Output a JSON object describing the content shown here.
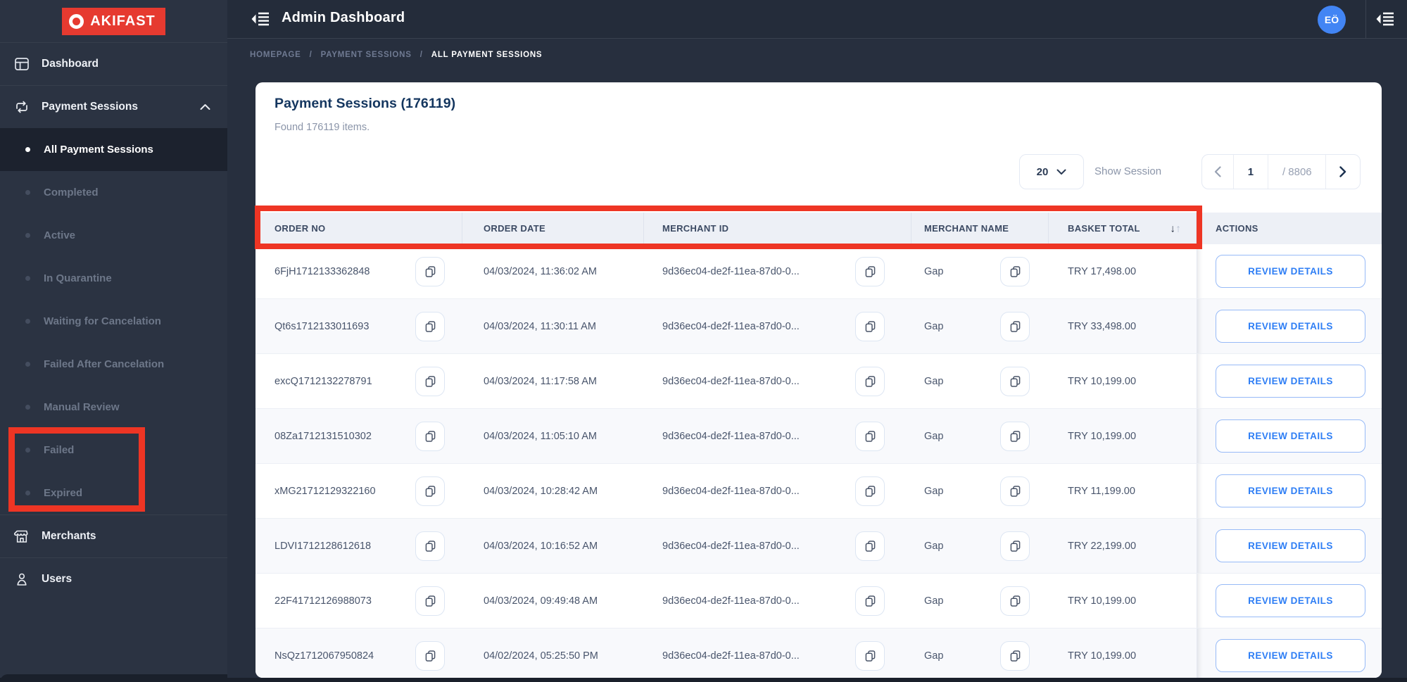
{
  "brand": {
    "logo_text": "AKIFAST"
  },
  "topbar": {
    "title": "Admin Dashboard",
    "avatar_initials": "EÖ"
  },
  "breadcrumb": {
    "separator": "/",
    "items": [
      "HOMEPAGE",
      "PAYMENT SESSIONS",
      "ALL PAYMENT SESSIONS"
    ]
  },
  "sidebar": {
    "items": [
      {
        "label": "Dashboard",
        "icon": "dashboard-icon",
        "type": "main"
      },
      {
        "label": "Payment Sessions",
        "icon": "payment-sessions-icon",
        "type": "main",
        "expanded": true
      },
      {
        "label": "All Payment Sessions",
        "type": "sub",
        "active": true
      },
      {
        "label": "Completed",
        "type": "sub"
      },
      {
        "label": "Active",
        "type": "sub"
      },
      {
        "label": "In Quarantine",
        "type": "sub"
      },
      {
        "label": "Waiting for Cancelation",
        "type": "sub"
      },
      {
        "label": "Failed After Cancelation",
        "type": "sub"
      },
      {
        "label": "Manual Review",
        "type": "sub"
      },
      {
        "label": "Failed",
        "type": "sub"
      },
      {
        "label": "Expired",
        "type": "sub"
      },
      {
        "label": "Merchants",
        "icon": "merchants-icon",
        "type": "main"
      },
      {
        "label": "Users",
        "icon": "users-icon",
        "type": "main"
      }
    ]
  },
  "page": {
    "title": "Payment Sessions (176119)",
    "subtitle": "Found 176119 items.",
    "page_size": "20",
    "page_size_label": "Show Session",
    "pager": {
      "current": "1",
      "total": "/ 8806"
    }
  },
  "table": {
    "columns": [
      "ORDER NO",
      "ORDER DATE",
      "MERCHANT ID",
      "MERCHANT NAME",
      "BASKET TOTAL",
      "ACTIONS"
    ],
    "sorted_column": "BASKET TOTAL",
    "action_label": "REVIEW DETAILS",
    "rows": [
      {
        "order_no": "6FjH1712133362848",
        "order_date": "04/03/2024, 11:36:02 AM",
        "merchant_id": "9d36ec04-de2f-11ea-87d0-0...",
        "merchant_name": "Gap",
        "basket_total": "TRY 17,498.00"
      },
      {
        "order_no": "Qt6s1712133011693",
        "order_date": "04/03/2024, 11:30:11 AM",
        "merchant_id": "9d36ec04-de2f-11ea-87d0-0...",
        "merchant_name": "Gap",
        "basket_total": "TRY 33,498.00"
      },
      {
        "order_no": "excQ1712132278791",
        "order_date": "04/03/2024, 11:17:58 AM",
        "merchant_id": "9d36ec04-de2f-11ea-87d0-0...",
        "merchant_name": "Gap",
        "basket_total": "TRY 10,199.00"
      },
      {
        "order_no": "08Za1712131510302",
        "order_date": "04/03/2024, 11:05:10 AM",
        "merchant_id": "9d36ec04-de2f-11ea-87d0-0...",
        "merchant_name": "Gap",
        "basket_total": "TRY 10,199.00"
      },
      {
        "order_no": "xMG21712129322160",
        "order_date": "04/03/2024, 10:28:42 AM",
        "merchant_id": "9d36ec04-de2f-11ea-87d0-0...",
        "merchant_name": "Gap",
        "basket_total": "TRY 11,199.00"
      },
      {
        "order_no": "LDVI1712128612618",
        "order_date": "04/03/2024, 10:16:52 AM",
        "merchant_id": "9d36ec04-de2f-11ea-87d0-0...",
        "merchant_name": "Gap",
        "basket_total": "TRY 22,199.00"
      },
      {
        "order_no": "22F41712126988073",
        "order_date": "04/03/2024, 09:49:48 AM",
        "merchant_id": "9d36ec04-de2f-11ea-87d0-0...",
        "merchant_name": "Gap",
        "basket_total": "TRY 10,199.00"
      },
      {
        "order_no": "NsQz1712067950824",
        "order_date": "04/02/2024, 05:25:50 PM",
        "merchant_id": "9d36ec04-de2f-11ea-87d0-0...",
        "merchant_name": "Gap",
        "basket_total": "TRY 10,199.00"
      }
    ]
  },
  "annotations": {
    "color": "#ee3524"
  },
  "colors": {
    "accent_blue": "#2e7ef5",
    "avatar_blue": "#4285f4",
    "brand_red": "#e63a30",
    "sidebar_bg": "#2b3342",
    "topbar_bg": "#242c3a",
    "content_bg": "#272f3e",
    "table_header_bg": "#edf0f6",
    "title_navy": "#14365f"
  }
}
